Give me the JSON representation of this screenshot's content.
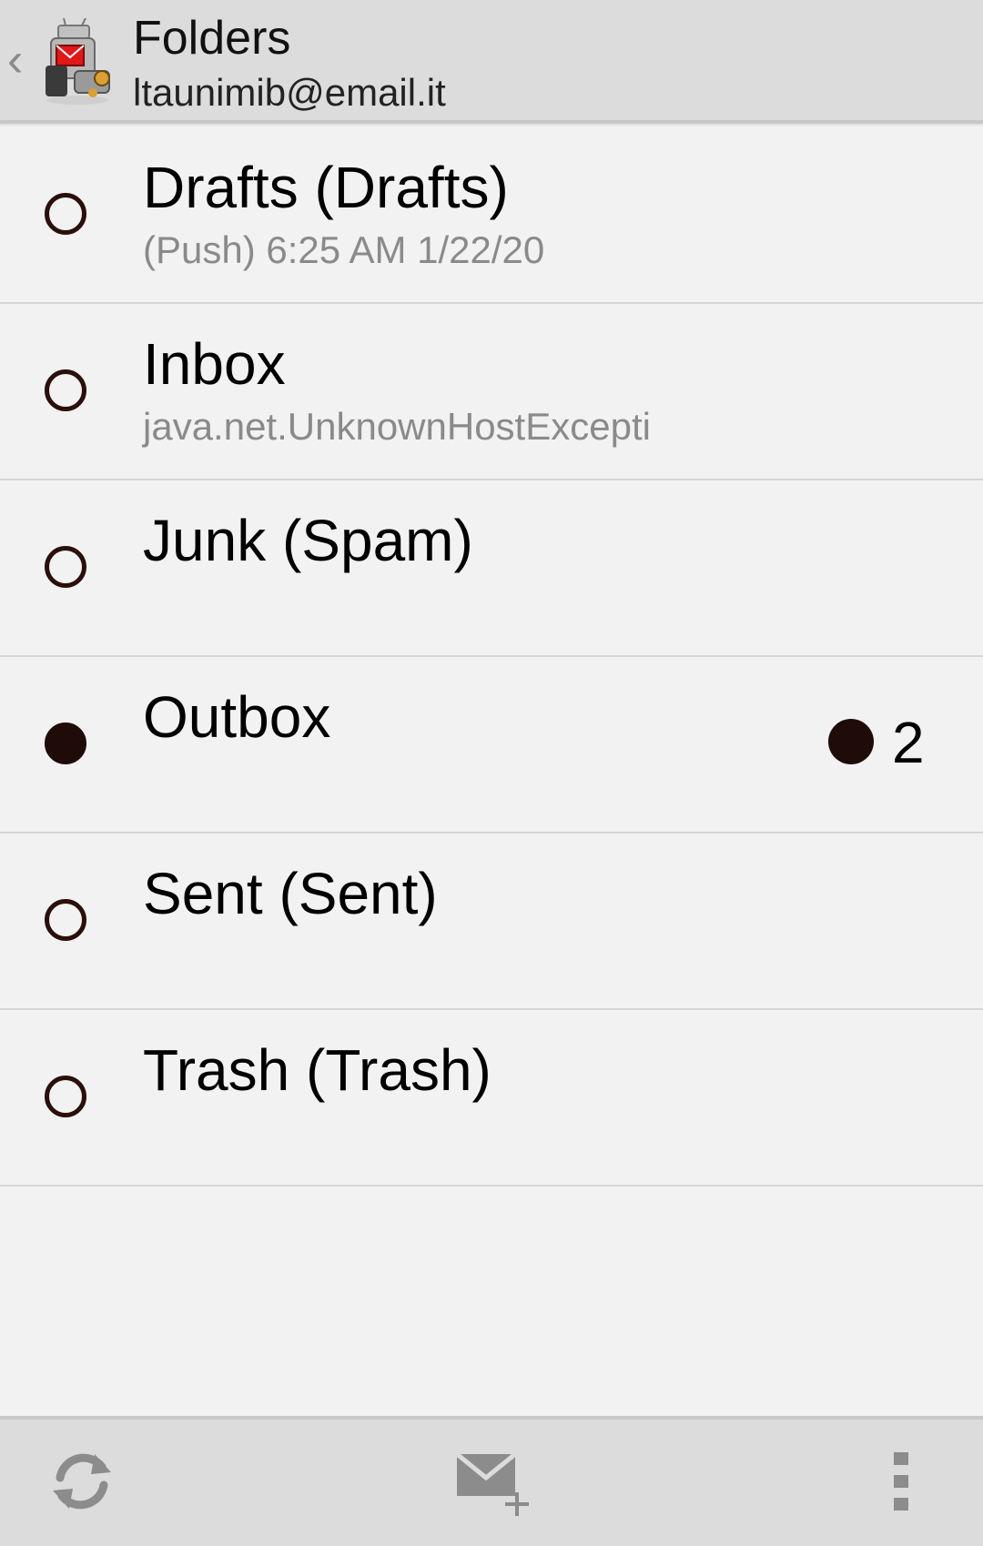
{
  "header": {
    "title": "Folders",
    "account": "ltaunimib@email.it",
    "up_icon": "chevron-left-icon",
    "app_icon": "k9-mail-robot-icon"
  },
  "folders": [
    {
      "name": "Drafts (Drafts)",
      "status": "(Push) 6:25 AM 1/22/20",
      "filled": false,
      "count": ""
    },
    {
      "name": "Inbox",
      "status": "java.net.UnknownHostExcepti",
      "filled": false,
      "count": ""
    },
    {
      "name": "Junk (Spam)",
      "status": "",
      "filled": false,
      "count": ""
    },
    {
      "name": "Outbox",
      "status": "",
      "filled": true,
      "count": "2"
    },
    {
      "name": "Sent (Sent)",
      "status": "",
      "filled": false,
      "count": ""
    },
    {
      "name": "Trash (Trash)",
      "status": "",
      "filled": false,
      "count": ""
    }
  ],
  "bottom_bar": {
    "refresh_icon": "refresh-icon",
    "compose_icon": "compose-mail-icon",
    "overflow_icon": "overflow-menu-icon"
  },
  "colors": {
    "bar_background": "#dcdcdc",
    "list_background": "#f2f2f2",
    "dot_color": "#1f0b08",
    "secondary_text": "#8a8a8a"
  }
}
